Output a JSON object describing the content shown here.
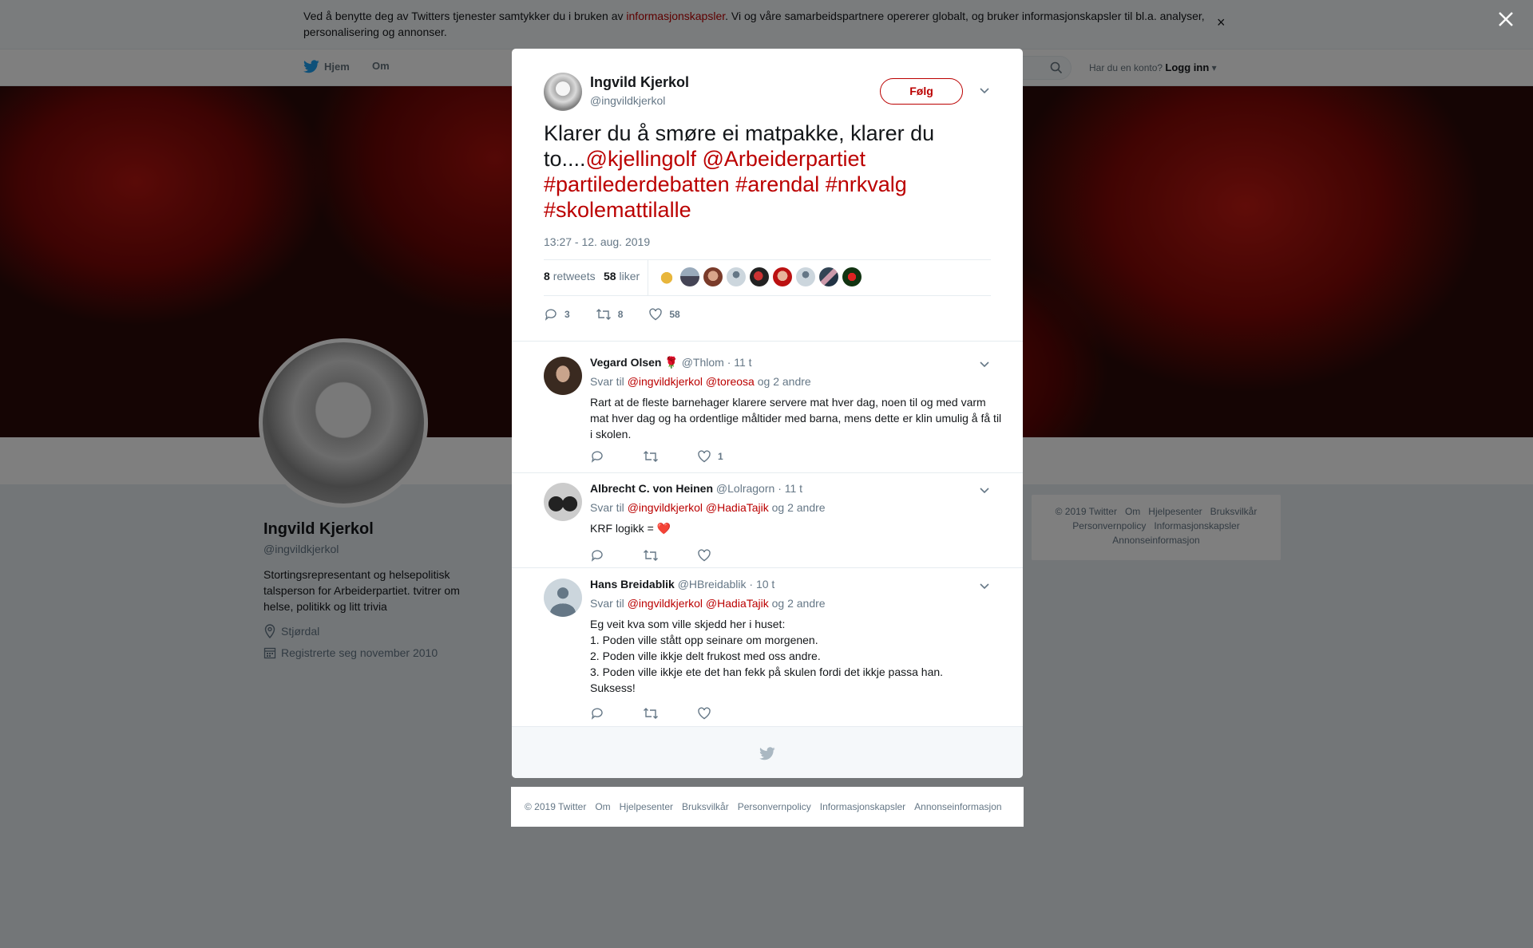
{
  "cookie": {
    "text_before": "Ved å benytte deg av Twitters tjenester samtykker du i bruken av ",
    "link": "informasjonskapsler",
    "text_after": ". Vi og våre samarbeidspartnere opererer globalt, og bruker informasjonskapsler til bl.a. analyser, personalisering og annonser.",
    "close": "×"
  },
  "nav": {
    "home": "Hjem",
    "about": "Om",
    "login_prompt": "Har du en konto?",
    "login": "Logg inn"
  },
  "profile": {
    "name": "Ingvild Kjerkol",
    "handle": "@ingvildkjerkol",
    "bio": "Stortingsrepresentant og helsepolitisk talsperson for Arbeiderpartiet. tvitrer om helse, politikk og litt trivia",
    "location": "Stjørdal",
    "joined": "Registrerte seg november 2010"
  },
  "side_footer": {
    "row1": [
      "© 2019 Twitter",
      "Om",
      "Hjelpesenter",
      "Bruksvilkår"
    ],
    "row2": [
      "Personvernpolicy",
      "Informasjonskapsler"
    ],
    "row3": [
      "Annonseinformasjon"
    ]
  },
  "tweet": {
    "name": "Ingvild Kjerkol",
    "handle": "@ingvildkjerkol",
    "follow": "Følg",
    "text_plain": "Klarer du å smøre ei matpakke, klarer du to....",
    "text_links": "@kjellingolf @Arbeiderpartiet #partilederdebatten #arendal #nrkvalg #skolemattilalle",
    "time": "13:27 - 12. aug. 2019",
    "retweets_count": "8",
    "retweets_label": "retweets",
    "likes_count": "58",
    "likes_label": "liker",
    "actions": {
      "replies": "3",
      "retweets": "8",
      "likes": "58"
    }
  },
  "replies": [
    {
      "name": "Vegard Olsen",
      "badge": "🌹",
      "handle": "@Thlom",
      "time": "· 11 t",
      "to_prefix": "Svar til",
      "to_links": "@ingvildkjerkol @toreosa",
      "to_suffix": "og 2 andre",
      "body": "Rart at de fleste barnehager klarere servere mat hver dag, noen til og med varm mat hver dag og ha ordentlige måltider med barna, mens dette er klin umulig å få til i skolen.",
      "likes": "1"
    },
    {
      "name": "Albrecht C. von Heinen",
      "handle": "@Lolragorn",
      "time": "· 11 t",
      "to_prefix": "Svar til",
      "to_links": "@ingvildkjerkol @HadiaTajik",
      "to_suffix": "og 2 andre",
      "body": "KRF logikk = ",
      "emoji": "❤️"
    },
    {
      "name": "Hans Breidablik",
      "handle": "@HBreidablik",
      "time": "· 10 t",
      "to_prefix": "Svar til",
      "to_links": "@ingvildkjerkol @HadiaTajik",
      "to_suffix": "og 2 andre",
      "body_lines": [
        "Eg veit kva som ville skjedd her i huset:",
        "1. Poden ville stått opp seinare om morgenen.",
        "2. Poden ville ikkje delt frukost med oss andre.",
        "3. Poden ville ikkje ete det han fekk på skulen fordi det ikkje passa han.",
        "Suksess!"
      ]
    }
  ],
  "modal_footer": [
    "© 2019 Twitter",
    "Om",
    "Hjelpesenter",
    "Bruksvilkår",
    "Personvernpolicy",
    "Informasjonskapsler",
    "Annonseinformasjon"
  ],
  "colors": {
    "accent": "#bb0000",
    "twitter_blue": "#1da1f2",
    "muted": "#657786"
  }
}
